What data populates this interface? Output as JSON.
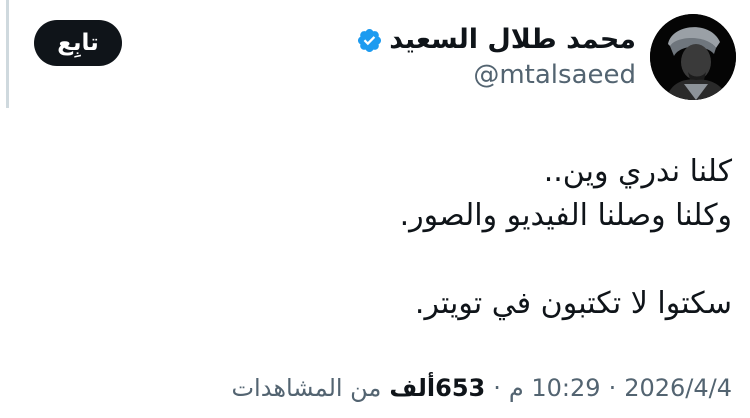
{
  "author": {
    "display_name": "محمد طلال السعيد",
    "handle": "@mtalsaeed",
    "verified_icon": "verified-badge-icon",
    "verified_color": "#1d9bf0"
  },
  "follow_button": {
    "label": "تابِع"
  },
  "tweet": {
    "lines": [
      "كلنا ندري وين..",
      "وكلنا وصلنا الفيديو والصور.",
      "سكتوا لا تكتبون في تويتر."
    ]
  },
  "meta": {
    "time": "10:29 م",
    "date": "2026/4/4",
    "separator": "·",
    "views_count": "653ألف",
    "views_label": "من المشاهدات"
  },
  "colors": {
    "text_primary": "#0f1419",
    "text_secondary": "#536471",
    "button_bg": "#0f1419",
    "button_text": "#ffffff"
  }
}
